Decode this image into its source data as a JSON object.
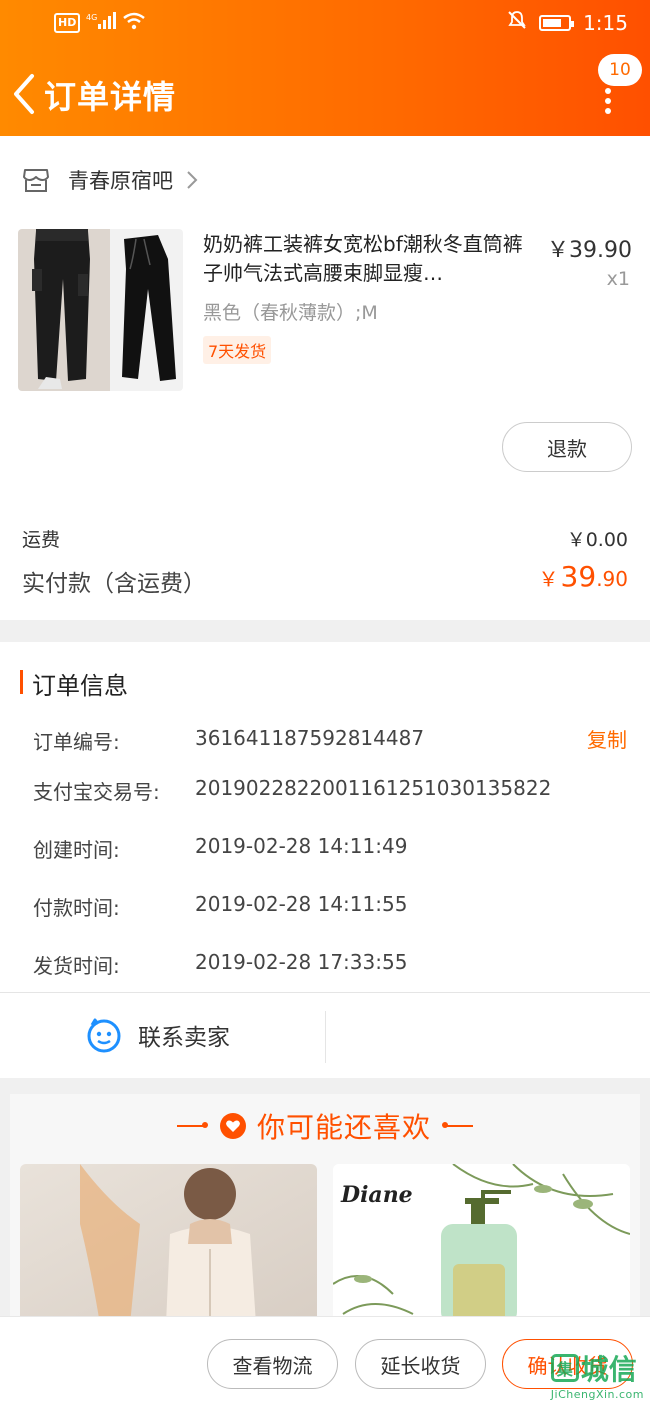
{
  "status_bar": {
    "network": "HD",
    "signal": "4G",
    "time": "1:15"
  },
  "nav": {
    "title": "订单详情",
    "badge_count": "10"
  },
  "shop": {
    "name": "青春原宿吧"
  },
  "product": {
    "title": "奶奶裤工装裤女宽松bf潮秋冬直筒裤子帅气法式高腰束脚显瘦…",
    "price": "￥39.90",
    "qty": "x1",
    "sku": "黑色（春秋薄款）;M",
    "tag": "7天发货",
    "refund_label": "退款"
  },
  "summary": {
    "shipping_label": "运费",
    "shipping_value": "￥0.00",
    "paid_label": "实付款（含运费）",
    "paid_currency": "￥",
    "paid_int": "39",
    "paid_dec": ".90"
  },
  "order_info": {
    "title": "订单信息",
    "copy_label": "复制",
    "rows": [
      {
        "key": "订单编号:",
        "value": "361641187592814487"
      },
      {
        "key": "支付宝交易号:",
        "value": "2019022822001161251030135822"
      },
      {
        "key": "创建时间:",
        "value": "2019-02-28 14:11:49"
      },
      {
        "key": "付款时间:",
        "value": "2019-02-28 14:11:55"
      },
      {
        "key": "发货时间:",
        "value": "2019-02-28 17:33:55"
      }
    ]
  },
  "contact": {
    "label": "联系卖家"
  },
  "recommend": {
    "title": "你可能还喜欢",
    "brand": "Diane"
  },
  "bottom_actions": {
    "logistics": "查看物流",
    "extend": "延长收货",
    "confirm": "确认收货"
  },
  "watermark": {
    "text": "城信",
    "sub": "JiChengXin.com"
  },
  "colors": {
    "accent": "#ff5000",
    "header_start": "#ff8a00",
    "header_end": "#ff5000"
  }
}
